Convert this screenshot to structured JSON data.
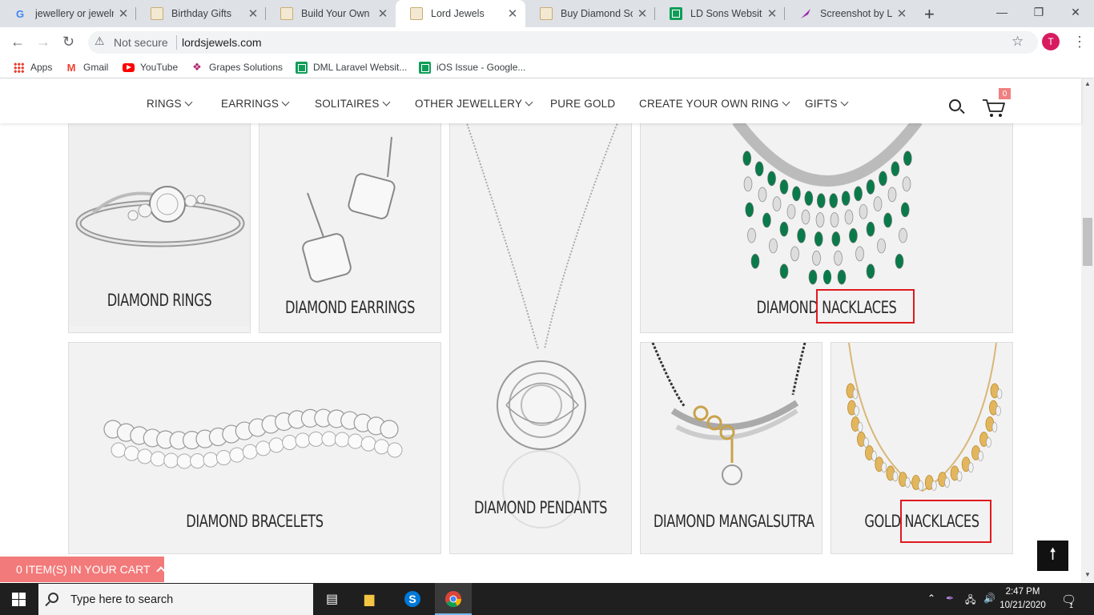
{
  "browser": {
    "tabs": [
      {
        "title": "jewellery or jewelr",
        "favicon": "google-icon"
      },
      {
        "title": "Birthday Gifts",
        "favicon": "lord-jewels-icon"
      },
      {
        "title": "Build Your Own Di",
        "favicon": "lord-jewels-icon"
      },
      {
        "title": "Lord Jewels",
        "favicon": "lord-jewels-icon",
        "active": true
      },
      {
        "title": "Buy Diamond Solit",
        "favicon": "lord-jewels-icon"
      },
      {
        "title": "LD Sons Website I",
        "favicon": "sheets-icon"
      },
      {
        "title": "Screenshot by Ligh",
        "favicon": "lightshot-icon"
      }
    ],
    "security_label": "Not secure",
    "url": "lordsjewels.com",
    "profile_initial": "T",
    "bookmarks": [
      {
        "label": "Apps",
        "icon": "apps-grid-icon"
      },
      {
        "label": "Gmail",
        "icon": "gmail-icon"
      },
      {
        "label": "YouTube",
        "icon": "youtube-icon"
      },
      {
        "label": "Grapes Solutions",
        "icon": "grapes-icon"
      },
      {
        "label": "DML Laravel Websit...",
        "icon": "sheets-icon"
      },
      {
        "label": "iOS Issue - Google...",
        "icon": "sheets-icon"
      }
    ]
  },
  "site": {
    "nav": [
      {
        "label": "RINGS",
        "has_dropdown": true
      },
      {
        "label": "EARRINGS",
        "has_dropdown": true
      },
      {
        "label": "SOLITAIRES",
        "has_dropdown": true
      },
      {
        "label": "OTHER JEWELLERY",
        "has_dropdown": true
      },
      {
        "label": "PURE GOLD",
        "has_dropdown": false
      },
      {
        "label": "CREATE YOUR OWN RING",
        "has_dropdown": true
      },
      {
        "label": "GIFTS",
        "has_dropdown": true
      }
    ],
    "cart_count": "0",
    "categories": [
      {
        "label": "DIAMOND RINGS"
      },
      {
        "label": "DIAMOND EARRINGS"
      },
      {
        "label": "DIAMOND PENDANTS"
      },
      {
        "label": "DIAMOND NACKLACES",
        "highlighted_word": "NACKLACES"
      },
      {
        "label": "DIAMOND BRACELETS"
      },
      {
        "label": "DIAMOND MANGALSUTRA"
      },
      {
        "label": "GOLD NACKLACES",
        "highlighted_word": "NACKLACES"
      }
    ],
    "cart_bar": "0 ITEM(S) IN YOUR CART",
    "back_to_top_icon": "arrow-up-icon",
    "highlight_color": "#e0191e",
    "cart_bar_color": "#f37a7a"
  },
  "taskbar": {
    "search_placeholder": "Type here to search",
    "time": "2:47 PM",
    "date": "10/21/2020",
    "notification_count": "1"
  }
}
